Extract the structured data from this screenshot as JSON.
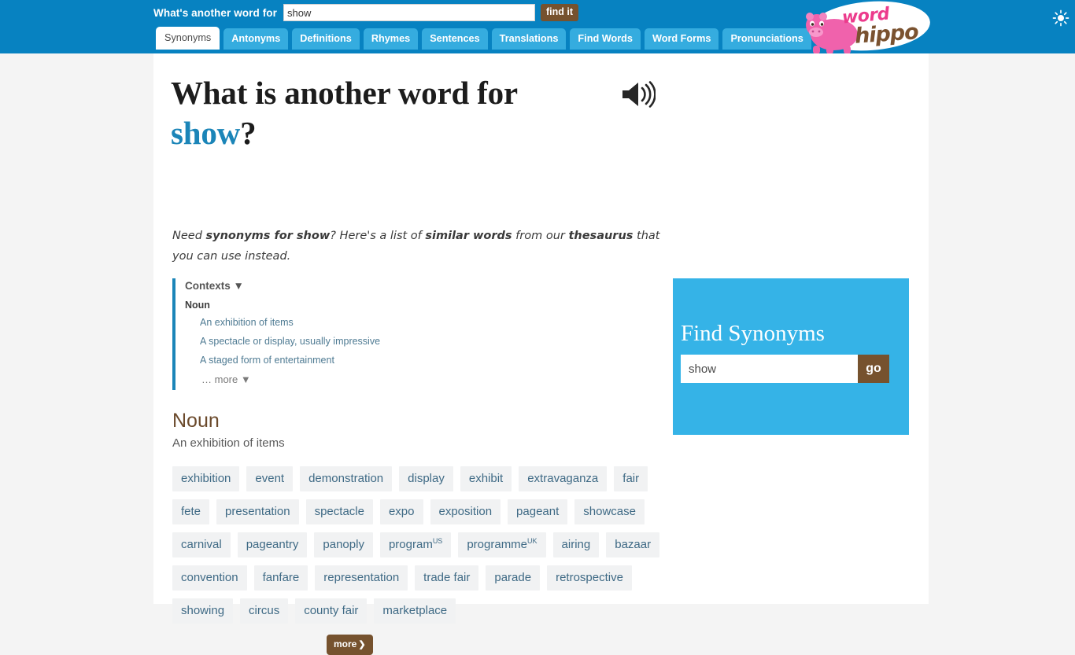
{
  "topbar": {
    "search_label": "What's another word for",
    "search_value": "show",
    "search_placeholder": "",
    "find_button": "find it",
    "theme_toggle_icon": "sun-icon"
  },
  "tabs": [
    {
      "label": "Synonyms",
      "active": true
    },
    {
      "label": "Antonyms",
      "active": false
    },
    {
      "label": "Definitions",
      "active": false
    },
    {
      "label": "Rhymes",
      "active": false
    },
    {
      "label": "Sentences",
      "active": false
    },
    {
      "label": "Translations",
      "active": false
    },
    {
      "label": "Find Words",
      "active": false
    },
    {
      "label": "Word Forms",
      "active": false
    },
    {
      "label": "Pronunciations",
      "active": false
    }
  ],
  "logo": {
    "word": "word",
    "hippo": "hippo",
    "word_color": "#ec3b8c",
    "hippo_color": "#7a5230"
  },
  "main": {
    "headline_prefix": "What is another word for",
    "headline_word": "show",
    "headline_suffix": "?",
    "speaker_icon": "speaker-icon",
    "intro": {
      "part1": "Need ",
      "bold1": "synonyms for show",
      "part2": "? Here's a list of ",
      "bold2": "similar words",
      "part3": " from our ",
      "bold3": "thesaurus",
      "part4": " that you can use instead."
    },
    "contexts": {
      "title": "Contexts ▼",
      "pos": "Noun",
      "items": [
        "An exhibition of items",
        "A spectacle or display, usually impressive",
        "A staged form of entertainment"
      ],
      "more": "… more ▼"
    },
    "section": {
      "pos": "Noun",
      "sense": "An exhibition of items",
      "collapse_icon": "triangle-up-icon"
    },
    "synonyms": [
      {
        "word": "exhibition",
        "sup": ""
      },
      {
        "word": "event",
        "sup": ""
      },
      {
        "word": "demonstration",
        "sup": ""
      },
      {
        "word": "display",
        "sup": ""
      },
      {
        "word": "exhibit",
        "sup": ""
      },
      {
        "word": "extravaganza",
        "sup": ""
      },
      {
        "word": "fair",
        "sup": ""
      },
      {
        "word": "fete",
        "sup": ""
      },
      {
        "word": "presentation",
        "sup": ""
      },
      {
        "word": "spectacle",
        "sup": ""
      },
      {
        "word": "expo",
        "sup": ""
      },
      {
        "word": "exposition",
        "sup": ""
      },
      {
        "word": "pageant",
        "sup": ""
      },
      {
        "word": "showcase",
        "sup": ""
      },
      {
        "word": "carnival",
        "sup": ""
      },
      {
        "word": "pageantry",
        "sup": ""
      },
      {
        "word": "panoply",
        "sup": ""
      },
      {
        "word": "program",
        "sup": "US"
      },
      {
        "word": "programme",
        "sup": "UK"
      },
      {
        "word": "airing",
        "sup": ""
      },
      {
        "word": "bazaar",
        "sup": ""
      },
      {
        "word": "convention",
        "sup": ""
      },
      {
        "word": "fanfare",
        "sup": ""
      },
      {
        "word": "representation",
        "sup": ""
      },
      {
        "word": "trade fair",
        "sup": ""
      },
      {
        "word": "parade",
        "sup": ""
      },
      {
        "word": "retrospective",
        "sup": ""
      },
      {
        "word": "showing",
        "sup": ""
      },
      {
        "word": "circus",
        "sup": ""
      },
      {
        "word": "county fair",
        "sup": ""
      },
      {
        "word": "marketplace",
        "sup": ""
      }
    ],
    "more_button": "more"
  },
  "sidebar": {
    "find_title": "Find Synonyms",
    "find_value": "show",
    "find_placeholder": "",
    "go_button": "go"
  },
  "colors": {
    "topbar_blue": "#0782c1",
    "tab_blue": "#35acdf",
    "accent_blue": "#1b85b8",
    "brown": "#76522e",
    "sidebar_blue": "#35b3e7",
    "chip_bg": "#f1f2f3",
    "chip_text": "#3f6a85",
    "page_bg": "#f4f4f4"
  }
}
